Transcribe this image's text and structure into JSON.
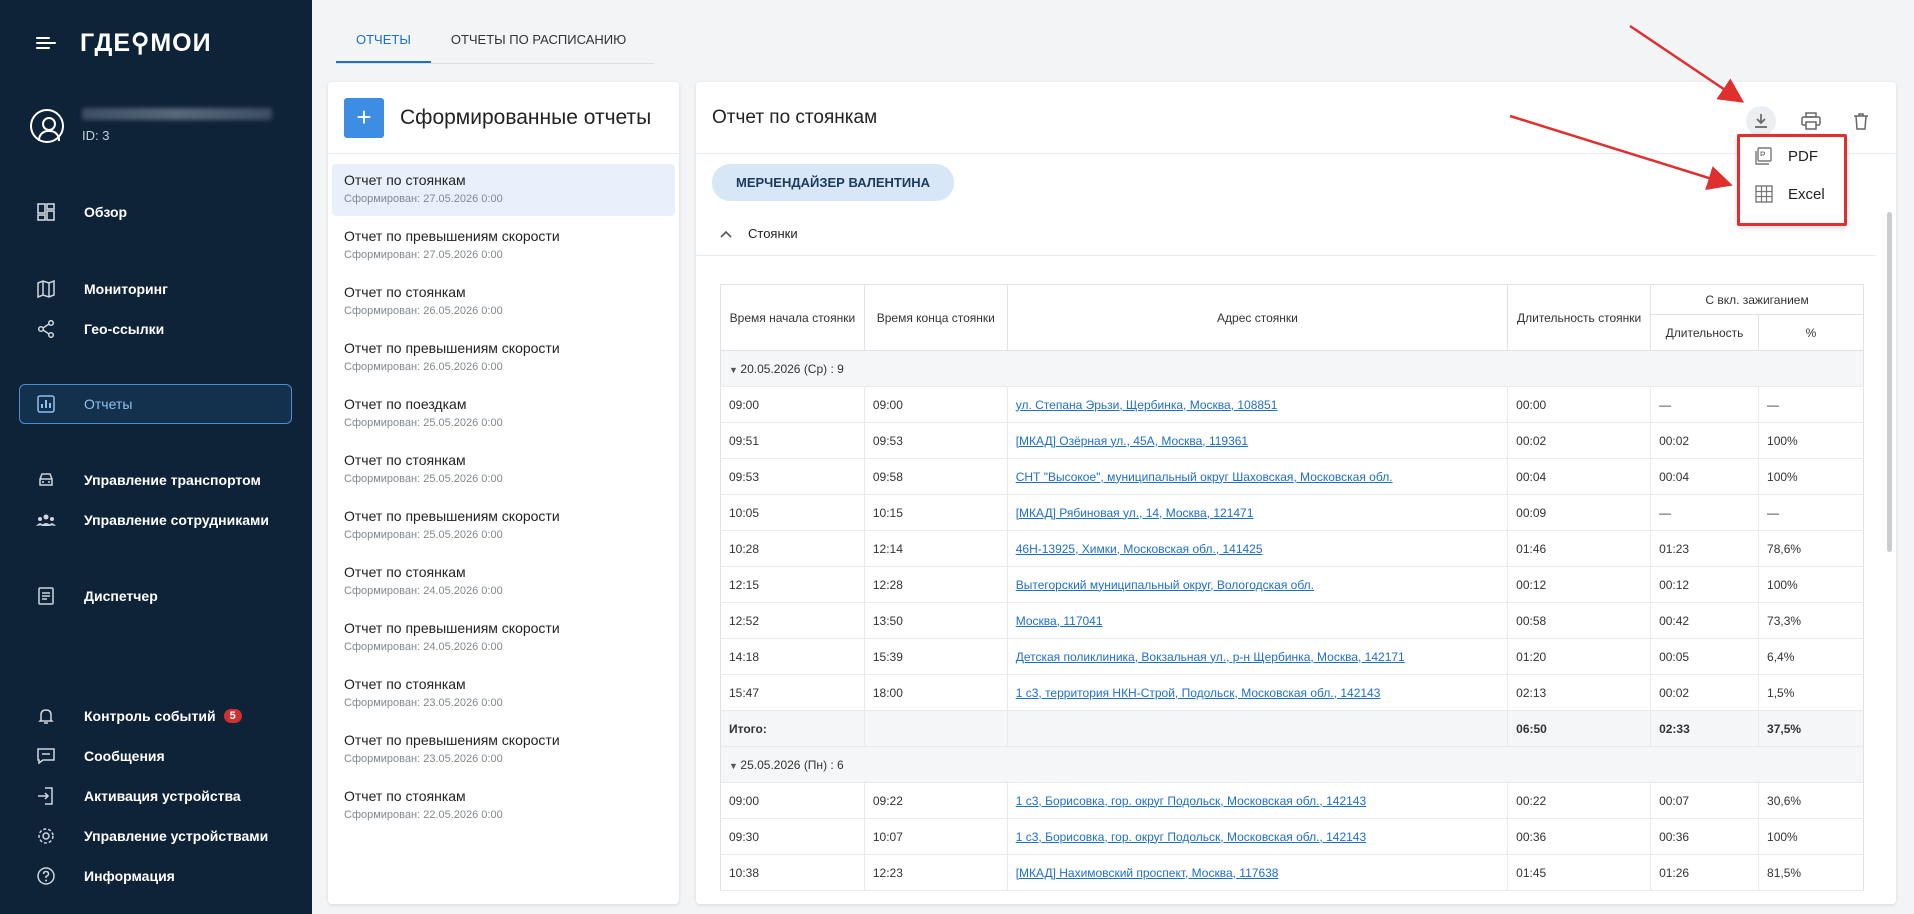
{
  "sidebar": {
    "logo": "ГДЕ⚲МОИ",
    "user": {
      "id": "ID: 3"
    },
    "items": [
      {
        "label": "Обзор",
        "icon": "dashboard-icon"
      },
      {
        "label": "Мониторинг",
        "icon": "map-icon"
      },
      {
        "label": "Гео-ссылки",
        "icon": "share-icon"
      },
      {
        "label": "Отчеты",
        "icon": "chart-icon",
        "active": true
      },
      {
        "label": "Управление транспортом",
        "icon": "car-icon"
      },
      {
        "label": "Управление сотрудниками",
        "icon": "people-icon"
      },
      {
        "label": "Диспетчер",
        "icon": "list-icon"
      },
      {
        "label": "Контроль событий",
        "icon": "bell-icon",
        "badge": "5"
      },
      {
        "label": "Сообщения",
        "icon": "message-icon"
      },
      {
        "label": "Активация устройства",
        "icon": "login-icon"
      },
      {
        "label": "Управление устройствами",
        "icon": "gear-icon"
      },
      {
        "label": "Информация",
        "icon": "help-icon"
      }
    ]
  },
  "tabs": [
    "ОТЧЕТЫ",
    "ОТЧЕТЫ ПО РАСПИСАНИЮ"
  ],
  "left_panel": {
    "add_label": "+",
    "title": "Сформированные отчеты",
    "reports": [
      {
        "name": "Отчет по стоянкам",
        "date": "Сформирован: 27.05.2026 0:00"
      },
      {
        "name": "Отчет по превышениям скорости",
        "date": "Сформирован: 27.05.2026 0:00"
      },
      {
        "name": "Отчет по стоянкам",
        "date": "Сформирован: 26.05.2026 0:00"
      },
      {
        "name": "Отчет по превышениям скорости",
        "date": "Сформирован: 26.05.2026 0:00"
      },
      {
        "name": "Отчет по поездкам",
        "date": "Сформирован: 25.05.2026 0:00"
      },
      {
        "name": "Отчет по стоянкам",
        "date": "Сформирован: 25.05.2026 0:00"
      },
      {
        "name": "Отчет по превышениям скорости",
        "date": "Сформирован: 25.05.2026 0:00"
      },
      {
        "name": "Отчет по стоянкам",
        "date": "Сформирован: 24.05.2026 0:00"
      },
      {
        "name": "Отчет по превышениям скорости",
        "date": "Сформирован: 24.05.2026 0:00"
      },
      {
        "name": "Отчет по стоянкам",
        "date": "Сформирован: 23.05.2026 0:00"
      },
      {
        "name": "Отчет по превышениям скорости",
        "date": "Сформирован: 23.05.2026 0:00"
      },
      {
        "name": "Отчет по стоянкам",
        "date": "Сформирован: 22.05.2026 0:00"
      }
    ]
  },
  "right_panel": {
    "title": "Отчет по стоянкам",
    "chip": "МЕРЧЕНДАЙЗЕР ВАЛЕНТИНА",
    "section": "Стоянки",
    "dropdown": [
      {
        "label": "PDF",
        "icon": "pdf-icon"
      },
      {
        "label": "Excel",
        "icon": "table-icon"
      }
    ],
    "table": {
      "headers": {
        "start": "Время начала стоянки",
        "end": "Время конца стоянки",
        "address": "Адрес стоянки",
        "duration": "Длительность стоянки",
        "ignition": "С вкл. зажиганием",
        "ign_duration": "Длительность",
        "ign_pct": "%"
      },
      "groups": [
        {
          "label": "20.05.2026 (Ср) : 9",
          "rows": [
            [
              "09:00",
              "09:00",
              "ул. Степана Эрьзи, Щербинка, Москва, 108851",
              "00:00",
              "—",
              "—"
            ],
            [
              "09:51",
              "09:53",
              "[МКАД] Озёрная ул., 45А, Москва, 119361",
              "00:02",
              "00:02",
              "100%"
            ],
            [
              "09:53",
              "09:58",
              "СНТ \"Высокое\", муниципальный округ Шаховская, Московская обл.",
              "00:04",
              "00:04",
              "100%"
            ],
            [
              "10:05",
              "10:15",
              "[МКАД] Рябиновая ул., 14, Москва, 121471",
              "00:09",
              "—",
              "—"
            ],
            [
              "10:28",
              "12:14",
              "46Н-13925, Химки, Московская обл., 141425",
              "01:46",
              "01:23",
              "78,6%"
            ],
            [
              "12:15",
              "12:28",
              "Вытегорский муниципальный округ, Вологодская обл.",
              "00:12",
              "00:12",
              "100%"
            ],
            [
              "12:52",
              "13:50",
              "Москва, 117041",
              "00:58",
              "00:42",
              "73,3%"
            ],
            [
              "14:18",
              "15:39",
              "Детская поликлиника, Вокзальная ул., р-н Щербинка, Москва, 142171",
              "01:20",
              "00:05",
              "6,4%"
            ],
            [
              "15:47",
              "18:00",
              "1 с3, территория НКН-Строй, Подольск, Московская обл., 142143",
              "02:13",
              "00:02",
              "1,5%"
            ]
          ],
          "total": {
            "label": "Итого:",
            "duration": "06:50",
            "ign_duration": "02:33",
            "ign_pct": "37,5%"
          }
        },
        {
          "label": "25.05.2026 (Пн) : 6",
          "rows": [
            [
              "09:00",
              "09:22",
              "1 с3, Борисовка, гор. округ Подольск, Московская обл., 142143",
              "00:22",
              "00:07",
              "30,6%"
            ],
            [
              "09:30",
              "10:07",
              "1 с3, Борисовка, гор. округ Подольск, Московская обл., 142143",
              "00:36",
              "00:36",
              "100%"
            ],
            [
              "10:38",
              "12:23",
              "[МКАД] Нахимовский проспект, Москва, 117638",
              "01:45",
              "01:26",
              "81,5%"
            ]
          ]
        }
      ]
    }
  },
  "colors": {
    "sidebar": "#0f2338",
    "accent": "#1d6fc9",
    "highlight": "#e02f2f"
  }
}
